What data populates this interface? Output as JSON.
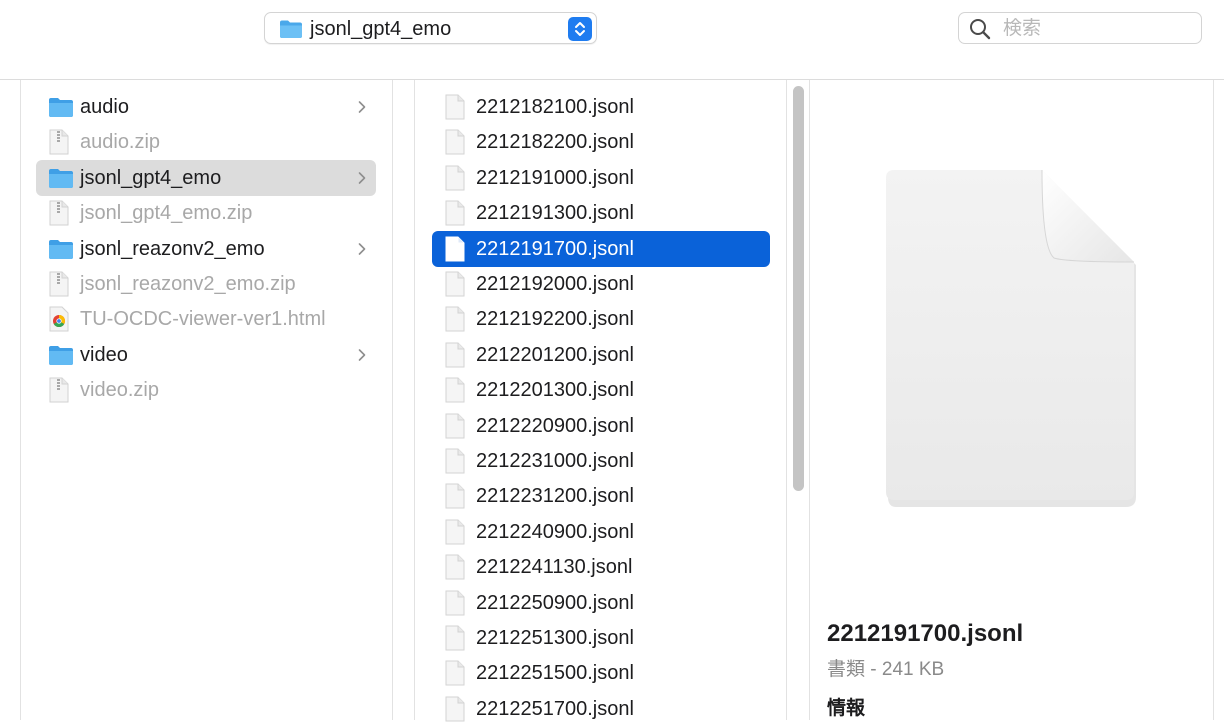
{
  "toolbar": {
    "path_label": "jsonl_gpt4_emo",
    "search_placeholder": "検索"
  },
  "parent_column": {
    "items": [
      {
        "name": "audio",
        "kind": "folder",
        "has_children": true
      },
      {
        "name": "audio.zip",
        "kind": "zip",
        "dim": true
      },
      {
        "name": "jsonl_gpt4_emo",
        "kind": "folder",
        "has_children": true,
        "open": true
      },
      {
        "name": "jsonl_gpt4_emo.zip",
        "kind": "zip",
        "dim": true
      },
      {
        "name": "jsonl_reazonv2_emo",
        "kind": "folder",
        "has_children": true
      },
      {
        "name": "jsonl_reazonv2_emo.zip",
        "kind": "zip",
        "dim": true
      },
      {
        "name": "TU-OCDC-viewer-ver1.html",
        "kind": "html",
        "dim": true
      },
      {
        "name": "video",
        "kind": "folder",
        "has_children": true
      },
      {
        "name": "video.zip",
        "kind": "zip",
        "dim": true
      }
    ]
  },
  "file_column": {
    "selected": "2212191700.jsonl",
    "items": [
      "2212182100.jsonl",
      "2212182200.jsonl",
      "2212191000.jsonl",
      "2212191300.jsonl",
      "2212191700.jsonl",
      "2212192000.jsonl",
      "2212192200.jsonl",
      "2212201200.jsonl",
      "2212201300.jsonl",
      "2212220900.jsonl",
      "2212231000.jsonl",
      "2212231200.jsonl",
      "2212240900.jsonl",
      "2212241130.jsonl",
      "2212250900.jsonl",
      "2212251300.jsonl",
      "2212251500.jsonl",
      "2212251700.jsonl"
    ]
  },
  "preview": {
    "file_name": "2212191700.jsonl",
    "kind_size": "書類 - 241 KB",
    "info_heading": "情報"
  },
  "colors": {
    "selection": "#0a62d9",
    "folder": "#5ab3ee",
    "open_folder_row": "#dcdcdc"
  }
}
